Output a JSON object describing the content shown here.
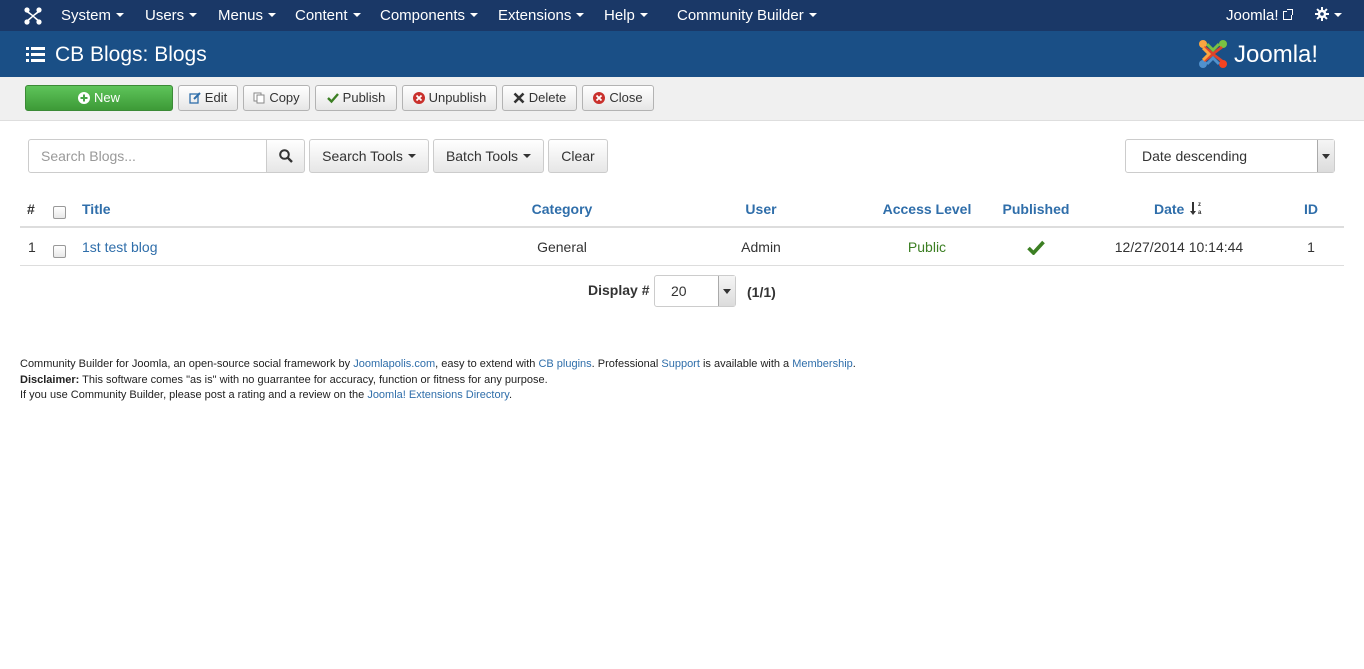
{
  "nav": {
    "items": [
      {
        "label": "System"
      },
      {
        "label": "Users"
      },
      {
        "label": "Menus"
      },
      {
        "label": "Content"
      },
      {
        "label": "Components"
      },
      {
        "label": "Extensions"
      },
      {
        "label": "Help"
      },
      {
        "label": "Community Builder"
      }
    ],
    "site_link": "Joomla!"
  },
  "header": {
    "title": "CB Blogs: Blogs",
    "brand": "Joomla!"
  },
  "toolbar": {
    "new_label": "New",
    "edit_label": "Edit",
    "copy_label": "Copy",
    "publish_label": "Publish",
    "unpublish_label": "Unpublish",
    "delete_label": "Delete",
    "close_label": "Close"
  },
  "filters": {
    "search_placeholder": "Search Blogs...",
    "search_tools_label": "Search Tools",
    "batch_tools_label": "Batch Tools",
    "clear_label": "Clear",
    "ordering_value": "Date descending"
  },
  "table": {
    "headers": {
      "num": "#",
      "title": "Title",
      "category": "Category",
      "user": "User",
      "access": "Access Level",
      "published": "Published",
      "date": "Date",
      "id": "ID"
    },
    "rows": [
      {
        "num": "1",
        "title": "1st test blog",
        "category": "General",
        "user": "Admin",
        "access": "Public",
        "published": true,
        "date": "12/27/2014 10:14:44",
        "id": "1"
      }
    ]
  },
  "pagination": {
    "display_label": "Display #",
    "limit_value": "20",
    "page_info": "(1/1)"
  },
  "footer": {
    "line1_a": "Community Builder for Joomla, an open-source social framework by ",
    "line1_link1": "Joomlapolis.com",
    "line1_b": ", easy to extend with ",
    "line1_link2": "CB plugins",
    "line1_c": ". Professional ",
    "line1_link3": "Support",
    "line1_d": " is available with a ",
    "line1_link4": "Membership",
    "line1_e": ".",
    "line2_bold": "Disclaimer:",
    "line2_text": " This software comes \"as is\" with no guarrantee for accuracy, function or fitness for any purpose.",
    "line3_a": "If you use Community Builder, please post a rating and a review on the ",
    "line3_link": "Joomla! Extensions Directory",
    "line3_b": "."
  },
  "colors": {
    "navbar": "#1a3867",
    "header": "#1a4f86",
    "link": "#2f6eaa",
    "new_button": "#46a546",
    "published_check": "#3c7f23"
  }
}
